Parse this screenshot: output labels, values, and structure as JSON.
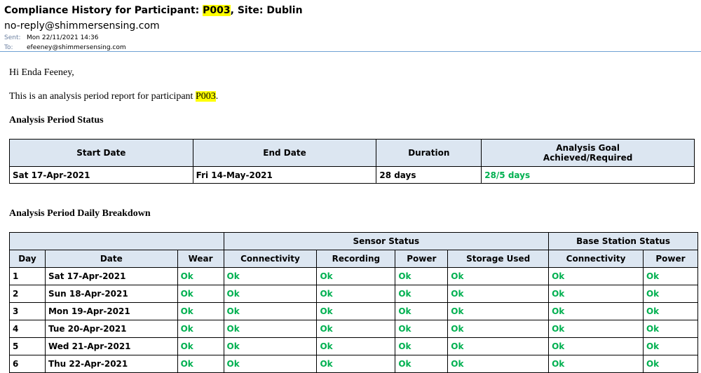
{
  "email": {
    "subject_prefix": "Compliance History for Participant: ",
    "participant": "P003",
    "subject_suffix": ", Site: Dublin",
    "sender": "no-reply@shimmersensing.com",
    "sent_label": "Sent:",
    "sent_value": "Mon 22/11/2021 14:36",
    "to_label": "To:",
    "to_value": "efeeney@shimmersensing.com"
  },
  "body": {
    "greeting": "Hi Enda Feeney,",
    "intro_prefix": "This is an analysis period report for participant ",
    "intro_participant": "P003",
    "intro_suffix": ".",
    "status_heading": "Analysis Period Status",
    "breakdown_heading": "Analysis Period Daily Breakdown"
  },
  "status_table": {
    "headers": [
      "Start Date",
      "End Date",
      "Duration",
      "Analysis Goal",
      "Achieved/Required"
    ],
    "row": [
      "Sat 17-Apr-2021",
      "Fri 14-May-2021",
      "28 days",
      "28/5 days"
    ]
  },
  "breakdown_table": {
    "group_headers": [
      "Sensor Status",
      "Base Station Status"
    ],
    "headers": [
      "Day",
      "Date",
      "Wear",
      "Connectivity",
      "Recording",
      "Power",
      "Storage Used",
      "Connectivity",
      "Power"
    ],
    "rows": [
      [
        "1",
        "Sat 17-Apr-2021",
        "Ok",
        "Ok",
        "Ok",
        "Ok",
        "Ok",
        "Ok",
        "Ok"
      ],
      [
        "2",
        "Sun 18-Apr-2021",
        "Ok",
        "Ok",
        "Ok",
        "Ok",
        "Ok",
        "Ok",
        "Ok"
      ],
      [
        "3",
        "Mon 19-Apr-2021",
        "Ok",
        "Ok",
        "Ok",
        "Ok",
        "Ok",
        "Ok",
        "Ok"
      ],
      [
        "4",
        "Tue 20-Apr-2021",
        "Ok",
        "Ok",
        "Ok",
        "Ok",
        "Ok",
        "Ok",
        "Ok"
      ],
      [
        "5",
        "Wed 21-Apr-2021",
        "Ok",
        "Ok",
        "Ok",
        "Ok",
        "Ok",
        "Ok",
        "Ok"
      ],
      [
        "6",
        "Thu 22-Apr-2021",
        "Ok",
        "Ok",
        "Ok",
        "Ok",
        "Ok",
        "Ok",
        "Ok"
      ]
    ]
  },
  "colors": {
    "ok": "#00b050",
    "header_bg": "#dce6f1",
    "highlight": "#ffff00"
  }
}
